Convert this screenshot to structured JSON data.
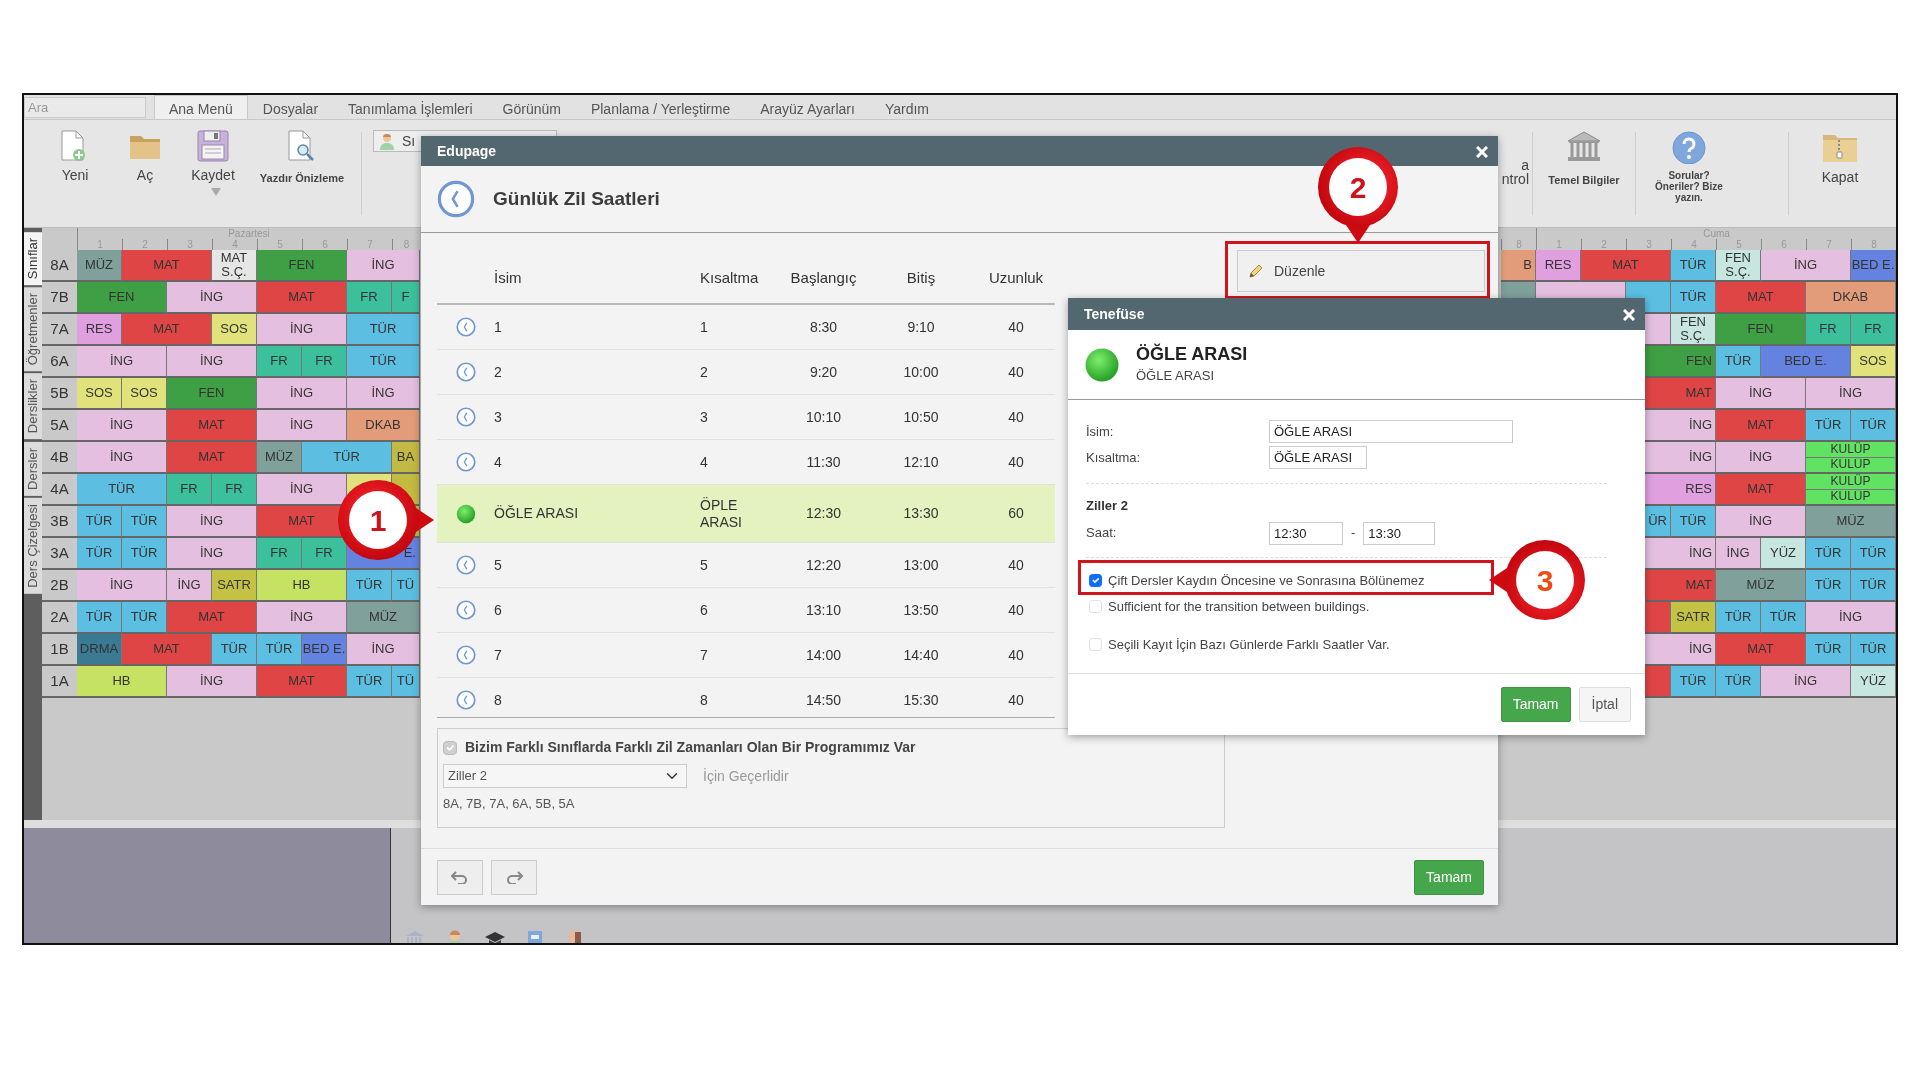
{
  "search": {
    "placeholder": "Ara"
  },
  "menu": [
    {
      "label": "Ana Menü",
      "selected": true
    },
    {
      "label": "Dosyalar",
      "selected": false
    },
    {
      "label": "Tanımlama İşlemleri",
      "selected": false
    },
    {
      "label": "Görünüm",
      "selected": false
    },
    {
      "label": "Planlama / Yerleştirme",
      "selected": false
    },
    {
      "label": "Arayüz Ayarları",
      "selected": false
    },
    {
      "label": "Yardım",
      "selected": false
    }
  ],
  "ribbon_left": [
    {
      "kind": "new",
      "label": "Yeni",
      "dropdown": false
    },
    {
      "kind": "open",
      "label": "Aç",
      "dropdown": false
    },
    {
      "kind": "save",
      "label": "Kaydet",
      "dropdown": true
    },
    {
      "kind": "preview",
      "label": "Yazdır Önizleme",
      "dropdown": false
    }
  ],
  "class_picker": {
    "value": "Sı"
  },
  "ribbon_right": [
    {
      "kind": "partial",
      "label": "a",
      "label_2": "ntrol"
    },
    {
      "kind": "bank",
      "label": "Temel Bilgiler"
    },
    {
      "kind": "help",
      "label": "Sorular? Öneriler? Bize yazın."
    },
    {
      "kind": "zip",
      "label": "Kapat"
    }
  ],
  "side_tabs": [
    {
      "label": "Sınıflar",
      "selected": true
    },
    {
      "label": "Öğretmenler",
      "selected": false
    },
    {
      "label": "Derslikler",
      "selected": false
    },
    {
      "label": "Dersler",
      "selected": false
    },
    {
      "label": "Ders Çizelgesi",
      "selected": false
    }
  ],
  "left_grid": {
    "day": "Pazartesi",
    "periods": [
      "1",
      "2",
      "3",
      "4",
      "5",
      "6",
      "7",
      "8"
    ],
    "rows": [
      {
        "label": "8A",
        "cells": [
          {
            "text": "MÜZ",
            "double": false,
            "color": "#80a09c"
          },
          {
            "text": "MAT",
            "double": true,
            "color": "#e04545"
          },
          {
            "text": "MAT S.Ç.",
            "double": false,
            "color": "#e6e6e6"
          },
          {
            "text": "FEN",
            "double": true,
            "color": "#3f9f45"
          },
          {
            "text": "İNG",
            "double": true,
            "color": "#e4bfe0"
          }
        ]
      },
      {
        "label": "7B",
        "cells": [
          {
            "text": "FEN",
            "double": true,
            "color": "#3f9f45"
          },
          {
            "text": "İNG",
            "double": true,
            "color": "#e4bfe0"
          },
          {
            "text": "MAT",
            "double": true,
            "color": "#e04545"
          },
          {
            "text": "FR",
            "double": false,
            "color": "#3cc09c"
          },
          {
            "text": "F",
            "double": false,
            "color": "#3cc09c"
          }
        ]
      },
      {
        "label": "7A",
        "cells": [
          {
            "text": "RES",
            "double": false,
            "color": "#e0a0e0"
          },
          {
            "text": "MAT",
            "double": true,
            "color": "#e04545"
          },
          {
            "text": "SOS",
            "double": false,
            "color": "#e2e27c"
          },
          {
            "text": "İNG",
            "double": true,
            "color": "#e4bfe0"
          },
          {
            "text": "TÜR",
            "double": true,
            "color": "#5cbfe2"
          }
        ]
      },
      {
        "label": "6A",
        "cells": [
          {
            "text": "İNG",
            "double": true,
            "color": "#e4bfe0"
          },
          {
            "text": "İNG",
            "double": true,
            "color": "#e4bfe0"
          },
          {
            "text": "FR",
            "double": false,
            "color": "#3cc09c"
          },
          {
            "text": "FR",
            "double": false,
            "color": "#3cc09c"
          },
          {
            "text": "TÜR",
            "double": true,
            "color": "#5cbfe2"
          }
        ]
      },
      {
        "label": "5B",
        "cells": [
          {
            "text": "SOS",
            "double": false,
            "color": "#e2e27c"
          },
          {
            "text": "SOS",
            "double": false,
            "color": "#e2e27c"
          },
          {
            "text": "FEN",
            "double": true,
            "color": "#3f9f45"
          },
          {
            "text": "İNG",
            "double": true,
            "color": "#e4bfe0"
          },
          {
            "text": "İNG",
            "double": true,
            "color": "#e4bfe0"
          }
        ]
      },
      {
        "label": "5A",
        "cells": [
          {
            "text": "İNG",
            "double": true,
            "color": "#e4bfe0"
          },
          {
            "text": "MAT",
            "double": true,
            "color": "#e04545"
          },
          {
            "text": "İNG",
            "double": true,
            "color": "#e4bfe0"
          },
          {
            "text": "DKAB",
            "double": true,
            "color": "#e29c7a"
          }
        ]
      },
      {
        "label": "4B",
        "cells": [
          {
            "text": "İNG",
            "double": true,
            "color": "#e4bfe0"
          },
          {
            "text": "MAT",
            "double": true,
            "color": "#e04545"
          },
          {
            "text": "MÜZ",
            "double": false,
            "color": "#80a09c"
          },
          {
            "text": "TÜR",
            "double": true,
            "color": "#5cbfe2"
          },
          {
            "text": "BA",
            "double": false,
            "color": "#c2ba42"
          }
        ]
      },
      {
        "label": "4A",
        "cells": [
          {
            "text": "TÜR",
            "double": true,
            "color": "#5cbfe2"
          },
          {
            "text": "FR",
            "double": false,
            "color": "#3cc09c"
          },
          {
            "text": "FR",
            "double": false,
            "color": "#3cc09c"
          },
          {
            "text": "İNG",
            "double": true,
            "color": "#e4bfe0"
          },
          {
            "double": false,
            "color": "#e2e27c"
          },
          {
            "double": false,
            "color": "#c2ba42"
          }
        ]
      },
      {
        "label": "3B",
        "cells": [
          {
            "text": "TÜR",
            "double": false,
            "color": "#5cbfe2"
          },
          {
            "text": "TÜR",
            "double": false,
            "color": "#5cbfe2"
          },
          {
            "text": "İNG",
            "double": true,
            "color": "#e4bfe0"
          },
          {
            "text": "MAT",
            "double": true,
            "color": "#e04545"
          },
          {
            "double": true,
            "color": "#c2ba42"
          }
        ]
      },
      {
        "label": "3A",
        "cells": [
          {
            "text": "TÜR",
            "double": false,
            "color": "#5cbfe2"
          },
          {
            "text": "TÜR",
            "double": false,
            "color": "#5cbfe2"
          },
          {
            "text": "İNG",
            "double": true,
            "color": "#e4bfe0"
          },
          {
            "text": "FR",
            "double": false,
            "color": "#3cc09c"
          },
          {
            "text": "FR",
            "double": false,
            "color": "#3cc09c"
          },
          {
            "text": "E.",
            "double": true,
            "clipped": true,
            "color": "#6483e0"
          }
        ]
      },
      {
        "label": "2B",
        "cells": [
          {
            "text": "İNG",
            "double": true,
            "color": "#e4bfe0"
          },
          {
            "text": "İNG",
            "double": false,
            "color": "#e4bfe0"
          },
          {
            "text": "SATR",
            "double": false,
            "color": "#c4c244"
          },
          {
            "text": "HB",
            "double": true,
            "color": "#c6e262"
          },
          {
            "text": "TÜR",
            "double": false,
            "color": "#5cbfe2"
          },
          {
            "text": "TÜ",
            "double": false,
            "color": "#5cbfe2"
          }
        ]
      },
      {
        "label": "2A",
        "cells": [
          {
            "text": "TÜR",
            "double": false,
            "color": "#5cbfe2"
          },
          {
            "text": "TÜR",
            "double": false,
            "color": "#5cbfe2"
          },
          {
            "text": "MAT",
            "double": true,
            "color": "#e04545"
          },
          {
            "text": "İNG",
            "double": true,
            "color": "#e4bfe0"
          },
          {
            "text": "MÜZ",
            "double": true,
            "color": "#80a09c"
          }
        ]
      },
      {
        "label": "1B",
        "cells": [
          {
            "text": "DRMA",
            "double": false,
            "color": "#3a7a92"
          },
          {
            "text": "MAT",
            "double": true,
            "color": "#e04545"
          },
          {
            "text": "TÜR",
            "double": false,
            "color": "#5cbfe2"
          },
          {
            "text": "TÜR",
            "double": false,
            "color": "#5cbfe2"
          },
          {
            "text": "BED E.",
            "double": false,
            "color": "#6483e0"
          },
          {
            "text": "İNG",
            "double": true,
            "color": "#e4bfe0"
          }
        ]
      },
      {
        "label": "1A",
        "cells": [
          {
            "text": "HB",
            "double": true,
            "color": "#c6e262"
          },
          {
            "text": "İNG",
            "double": true,
            "color": "#e4bfe0"
          },
          {
            "text": "MAT",
            "double": true,
            "color": "#e04545"
          },
          {
            "text": "TÜR",
            "double": false,
            "color": "#5cbfe2"
          },
          {
            "text": "TÜ",
            "double": false,
            "color": "#5cbfe2"
          }
        ]
      }
    ]
  },
  "right_grid": {
    "day": "Cuma",
    "previous_period": "8",
    "periods": [
      "1",
      "2",
      "3",
      "4",
      "5",
      "6",
      "7",
      "8"
    ],
    "rows": [
      {
        "cells": [
          {
            "text": "B",
            "double": false,
            "clipped": true,
            "color": "#e29c7a"
          },
          {
            "text": "RES",
            "double": false,
            "color": "#e0a0e0"
          },
          {
            "text": "MAT",
            "double": true,
            "color": "#e04545"
          },
          {
            "text": "TÜR",
            "double": false,
            "color": "#5cbfe2"
          },
          {
            "text": "FEN S.Ç.",
            "double": false,
            "color": "#c8e6e0"
          },
          {
            "text": "İNG",
            "double": true,
            "color": "#e4bfe0"
          },
          {
            "text": "BED E.",
            "double": false,
            "color": "#6483e0"
          }
        ]
      },
      {
        "cells": [
          {
            "double": false,
            "color": "#80a09c"
          },
          {
            "double": true,
            "color": "#e4bfe0"
          },
          {
            "double": false,
            "color": "#5cbfe2"
          },
          {
            "text": "TÜR",
            "double": false,
            "color": "#5cbfe2"
          },
          {
            "text": "MAT",
            "double": true,
            "color": "#e04545"
          },
          {
            "text": "DKAB",
            "double": true,
            "color": "#e29c7a"
          }
        ]
      },
      {
        "cells": [
          {
            "double": false,
            "color": "#e4bfe0"
          },
          {
            "text": "FEN S.Ç.",
            "double": false,
            "color": "#c8e6e0"
          },
          {
            "text": "FEN",
            "double": true,
            "color": "#3f9f45"
          },
          {
            "text": "FR",
            "double": false,
            "color": "#3cc09c"
          },
          {
            "text": "FR",
            "double": false,
            "color": "#3cc09c"
          }
        ]
      },
      {
        "cells": [
          {
            "text": "FEN",
            "double": true,
            "clipped": true,
            "color": "#3f9f45"
          },
          {
            "text": "TÜR",
            "double": false,
            "color": "#5cbfe2"
          },
          {
            "text": "BED E.",
            "double": true,
            "color": "#6483e0"
          },
          {
            "text": "SOS",
            "double": false,
            "color": "#e2e27c"
          }
        ]
      },
      {
        "cells": [
          {
            "text": "MAT",
            "double": true,
            "clipped": true,
            "color": "#e04545"
          },
          {
            "text": "İNG",
            "double": true,
            "color": "#e4bfe0"
          },
          {
            "text": "İNG",
            "double": true,
            "color": "#e4bfe0"
          }
        ]
      },
      {
        "cells": [
          {
            "text": "İNG",
            "double": true,
            "clipped": true,
            "color": "#e4bfe0"
          },
          {
            "text": "MAT",
            "double": true,
            "color": "#e04545"
          },
          {
            "text": "TÜR",
            "double": false,
            "color": "#5cbfe2"
          },
          {
            "text": "TÜR",
            "double": false,
            "color": "#5cbfe2"
          }
        ]
      },
      {
        "cells": [
          {
            "text": "İNG",
            "double": true,
            "clipped": true,
            "color": "#e4bfe0"
          },
          {
            "text": "İNG",
            "double": true,
            "color": "#e4bfe0"
          },
          {
            "parts": [
              "KULÜP",
              "KULÜP"
            ],
            "double": true,
            "color": "#62e262"
          }
        ]
      },
      {
        "cells": [
          {
            "text": "RES",
            "double": true,
            "clipped": true,
            "color": "#e0a0e0"
          },
          {
            "text": "MAT",
            "double": true,
            "color": "#e04545"
          },
          {
            "parts": [
              "KULÜP",
              "KULÜP"
            ],
            "double": true,
            "color": "#62e262"
          }
        ]
      },
      {
        "cells": [
          {
            "text": "ÜR",
            "double": false,
            "clipped": true,
            "color": "#5cbfe2"
          },
          {
            "text": "TÜR",
            "double": false,
            "color": "#5cbfe2"
          },
          {
            "text": "İNG",
            "double": true,
            "color": "#e4bfe0"
          },
          {
            "text": "MÜZ",
            "double": true,
            "color": "#80a09c"
          }
        ]
      },
      {
        "cells": [
          {
            "text": "İNG",
            "double": true,
            "clipped": true,
            "color": "#e4bfe0"
          },
          {
            "text": "İNG",
            "double": false,
            "color": "#e4bfe0"
          },
          {
            "text": "YÜZ",
            "double": false,
            "color": "#c8e6e0"
          },
          {
            "text": "TÜR",
            "double": false,
            "color": "#5cbfe2"
          },
          {
            "text": "TÜR",
            "double": false,
            "color": "#5cbfe2"
          }
        ]
      },
      {
        "cells": [
          {
            "text": "MAT",
            "double": true,
            "clipped": true,
            "color": "#e04545"
          },
          {
            "text": "MÜZ",
            "double": true,
            "color": "#80a09c"
          },
          {
            "text": "TÜR",
            "double": false,
            "color": "#5cbfe2"
          },
          {
            "text": "TÜR",
            "double": false,
            "color": "#5cbfe2"
          }
        ]
      },
      {
        "cells": [
          {
            "double": false,
            "color": "#e04545"
          },
          {
            "text": "SATR",
            "double": false,
            "color": "#c4c244"
          },
          {
            "text": "TÜR",
            "double": false,
            "color": "#5cbfe2"
          },
          {
            "text": "TÜR",
            "double": false,
            "color": "#5cbfe2"
          },
          {
            "text": "İNG",
            "double": true,
            "color": "#e4bfe0"
          }
        ]
      },
      {
        "cells": [
          {
            "text": "İNG",
            "double": true,
            "clipped": true,
            "color": "#e4bfe0"
          },
          {
            "text": "MAT",
            "double": true,
            "color": "#e04545"
          },
          {
            "text": "TÜR",
            "double": false,
            "color": "#5cbfe2"
          },
          {
            "text": "TÜR",
            "double": false,
            "color": "#5cbfe2"
          }
        ]
      },
      {
        "cells": [
          {
            "double": false,
            "color": "#e04545"
          },
          {
            "text": "TÜR",
            "double": false,
            "color": "#5cbfe2"
          },
          {
            "text": "TÜR",
            "double": false,
            "color": "#5cbfe2"
          },
          {
            "text": "İNG",
            "double": true,
            "color": "#e4bfe0"
          },
          {
            "text": "YÜZ",
            "double": false,
            "color": "#c8e6e0"
          }
        ]
      }
    ]
  },
  "bell_dialog": {
    "title": "Edupage",
    "heading": "Günlük Zil Saatleri",
    "edit_button": {
      "label": "Düzenle",
      "highlighted": true
    },
    "columns": [
      "İsim",
      "Kısaltma",
      "Başlangıç",
      "Bitiş",
      "Uzunluk"
    ],
    "rows": [
      {
        "kind": "lesson",
        "name": "1",
        "short": "1",
        "start": "8:30",
        "end": "9:10",
        "length": "40",
        "selected": false
      },
      {
        "kind": "lesson",
        "name": "2",
        "short": "2",
        "start": "9:20",
        "end": "10:00",
        "length": "40",
        "selected": false
      },
      {
        "kind": "lesson",
        "name": "3",
        "short": "3",
        "start": "10:10",
        "end": "10:50",
        "length": "40",
        "selected": false
      },
      {
        "kind": "lesson",
        "name": "4",
        "short": "4",
        "start": "11:30",
        "end": "12:10",
        "length": "40",
        "selected": false
      },
      {
        "kind": "break",
        "name": "ÖĞLE ARASI",
        "short": "ÖPLE ARASI",
        "start": "12:30",
        "end": "13:30",
        "length": "60",
        "selected": true
      },
      {
        "kind": "lesson",
        "name": "5",
        "short": "5",
        "start": "12:20",
        "end": "13:00",
        "length": "40",
        "selected": false
      },
      {
        "kind": "lesson",
        "name": "6",
        "short": "6",
        "start": "13:10",
        "end": "13:50",
        "length": "40",
        "selected": false
      },
      {
        "kind": "lesson",
        "name": "7",
        "short": "7",
        "start": "14:00",
        "end": "14:40",
        "length": "40",
        "selected": false
      },
      {
        "kind": "lesson",
        "name": "8",
        "short": "8",
        "start": "14:50",
        "end": "15:30",
        "length": "40",
        "selected": false
      }
    ],
    "different_bells": {
      "label": "Bizim Farklı Sınıflarda Farklı Zil Zamanları Olan Bir Programımız Var",
      "checked": true,
      "disabled": true
    },
    "bell_set": {
      "value": "Ziller 2"
    },
    "applies_label": "İçin Geçerlidir",
    "classes": "8A, 7B, 7A, 6A, 5B, 5A",
    "ok_button": "Tamam"
  },
  "break_dialog": {
    "title": "Tenefüse",
    "heading": "ÖĞLE ARASI",
    "subheading": "ÖĞLE ARASI",
    "fields": [
      {
        "label": "İsim:",
        "value": "ÖĞLE ARASI"
      },
      {
        "label": "Kısaltma:",
        "value": "ÖĞLE ARASI"
      }
    ],
    "group": "Ziller 2",
    "time_label": "Saat:",
    "start": "12:30",
    "separator": "-",
    "end": "13:30",
    "options": [
      {
        "label": "Çift Dersler Kaydın Öncesine ve Sonrasına Bölünemez",
        "checked": true,
        "highlighted": true
      },
      {
        "label": "Sufficient for the transition between buildings.",
        "checked": false,
        "highlighted": false
      },
      {
        "label": "Seçili Kayıt İçin Bazı Günlerde Farklı Saatler Var.",
        "checked": false,
        "highlighted": false
      }
    ],
    "ok_button": "Tamam",
    "cancel_button": "İptal"
  },
  "callouts": [
    {
      "number": "1"
    },
    {
      "number": "2"
    },
    {
      "number": "3"
    }
  ]
}
